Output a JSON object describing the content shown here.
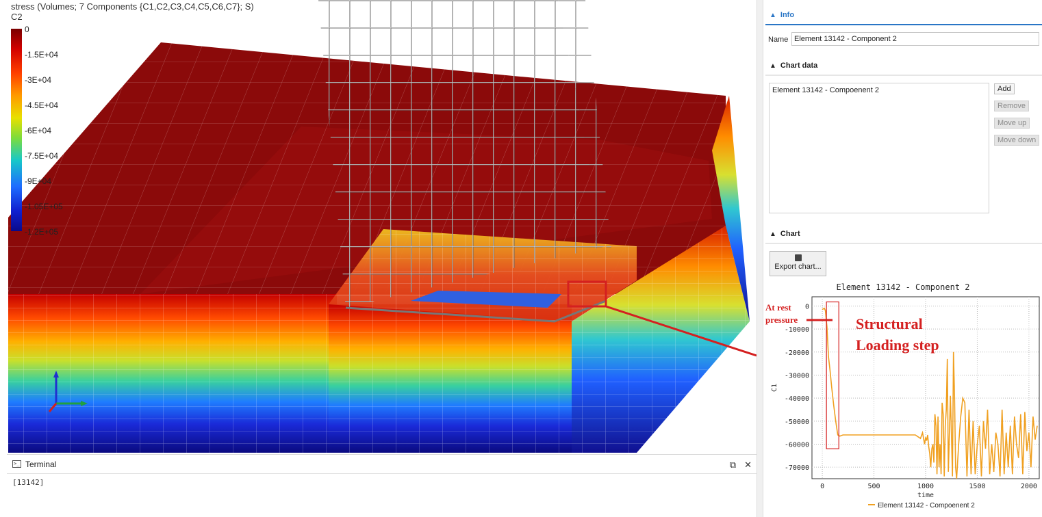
{
  "viewport": {
    "legend_title": "stress (Volumes; 7 Components {C1,C2,C3,C4,C5,C6,C7}; S)",
    "legend_component": "C2",
    "legend_ticks": [
      "0",
      "-1.5E+04",
      "-3E+04",
      "-4.5E+04",
      "-6E+04",
      "-7.5E+04",
      "-9E+04",
      "-1.05E+05",
      "-1.2E+05"
    ]
  },
  "terminal": {
    "title": "Terminal",
    "output": "[13142]"
  },
  "panel": {
    "info": {
      "header": "Info",
      "name_label": "Name",
      "name_value": "Element 13142 - Component 2"
    },
    "chart_data_section": {
      "header": "Chart data",
      "items": [
        "Element 13142 - Compoenent 2"
      ],
      "buttons": {
        "add": "Add",
        "remove": "Remove",
        "move_up": "Move up",
        "move_down": "Move down"
      }
    },
    "chart_section": {
      "header": "Chart",
      "export_label": "Export chart..."
    }
  },
  "annotations": {
    "at_rest": "At rest pressure",
    "structural": "Structural Loading step"
  },
  "colors": {
    "line": "#f0a020",
    "annotation": "#d42020",
    "info_accent": "#2a76c6"
  },
  "chart_data": {
    "type": "line",
    "title": "Element 13142 - Component 2",
    "xlabel": "time",
    "ylabel": "C1",
    "xlim": [
      -100,
      2100
    ],
    "ylim": [
      -75000,
      4000
    ],
    "x_ticks": [
      0,
      500,
      1000,
      1500,
      2000
    ],
    "y_ticks": [
      0,
      -10000,
      -20000,
      -30000,
      -40000,
      -50000,
      -60000,
      -70000
    ],
    "grid": true,
    "legend": "bottom",
    "series": [
      {
        "name": "Element 13142 - Compoenent 2",
        "x": [
          0,
          20,
          30,
          45,
          60,
          75,
          90,
          110,
          130,
          150,
          170,
          200,
          300,
          500,
          700,
          900,
          950,
          970,
          990,
          1000,
          1010,
          1020,
          1030,
          1040,
          1050,
          1060,
          1070,
          1080,
          1090,
          1100,
          1110,
          1120,
          1130,
          1140,
          1150,
          1160,
          1170,
          1180,
          1190,
          1200,
          1210,
          1220,
          1230,
          1240,
          1250,
          1260,
          1270,
          1280,
          1290,
          1300,
          1320,
          1340,
          1360,
          1380,
          1400,
          1420,
          1440,
          1460,
          1480,
          1500,
          1520,
          1540,
          1560,
          1580,
          1600,
          1620,
          1640,
          1660,
          1680,
          1700,
          1720,
          1740,
          1760,
          1780,
          1800,
          1820,
          1840,
          1860,
          1880,
          1900,
          1920,
          1940,
          1960,
          1980,
          2000,
          2020,
          2040,
          2060,
          2080
        ],
        "y": [
          -1500,
          -1000,
          -2000,
          -9000,
          -22000,
          -28000,
          -35000,
          -43000,
          -50000,
          -56000,
          -56500,
          -56000,
          -56000,
          -56000,
          -56000,
          -56000,
          -57500,
          -55000,
          -60000,
          -57000,
          -58500,
          -56000,
          -61000,
          -64000,
          -70000,
          -62000,
          -60000,
          -68000,
          -47000,
          -52000,
          -73000,
          -48000,
          -70000,
          -60000,
          -73000,
          -42000,
          -47000,
          -74000,
          -52000,
          -45000,
          -23000,
          -72000,
          -56000,
          -39000,
          -55000,
          -74000,
          -20000,
          -40000,
          -70000,
          -75000,
          -60000,
          -48000,
          -40000,
          -42000,
          -74000,
          -45000,
          -73000,
          -50000,
          -73000,
          -60000,
          -52000,
          -74000,
          -50000,
          -62000,
          -45000,
          -73000,
          -60000,
          -72000,
          -55000,
          -60000,
          -74000,
          -45000,
          -73000,
          -55000,
          -70000,
          -52000,
          -73000,
          -48000,
          -60000,
          -66000,
          -47000,
          -73000,
          -46000,
          -63000,
          -55000,
          -70000,
          -48000,
          -58000,
          -52000
        ]
      }
    ]
  }
}
